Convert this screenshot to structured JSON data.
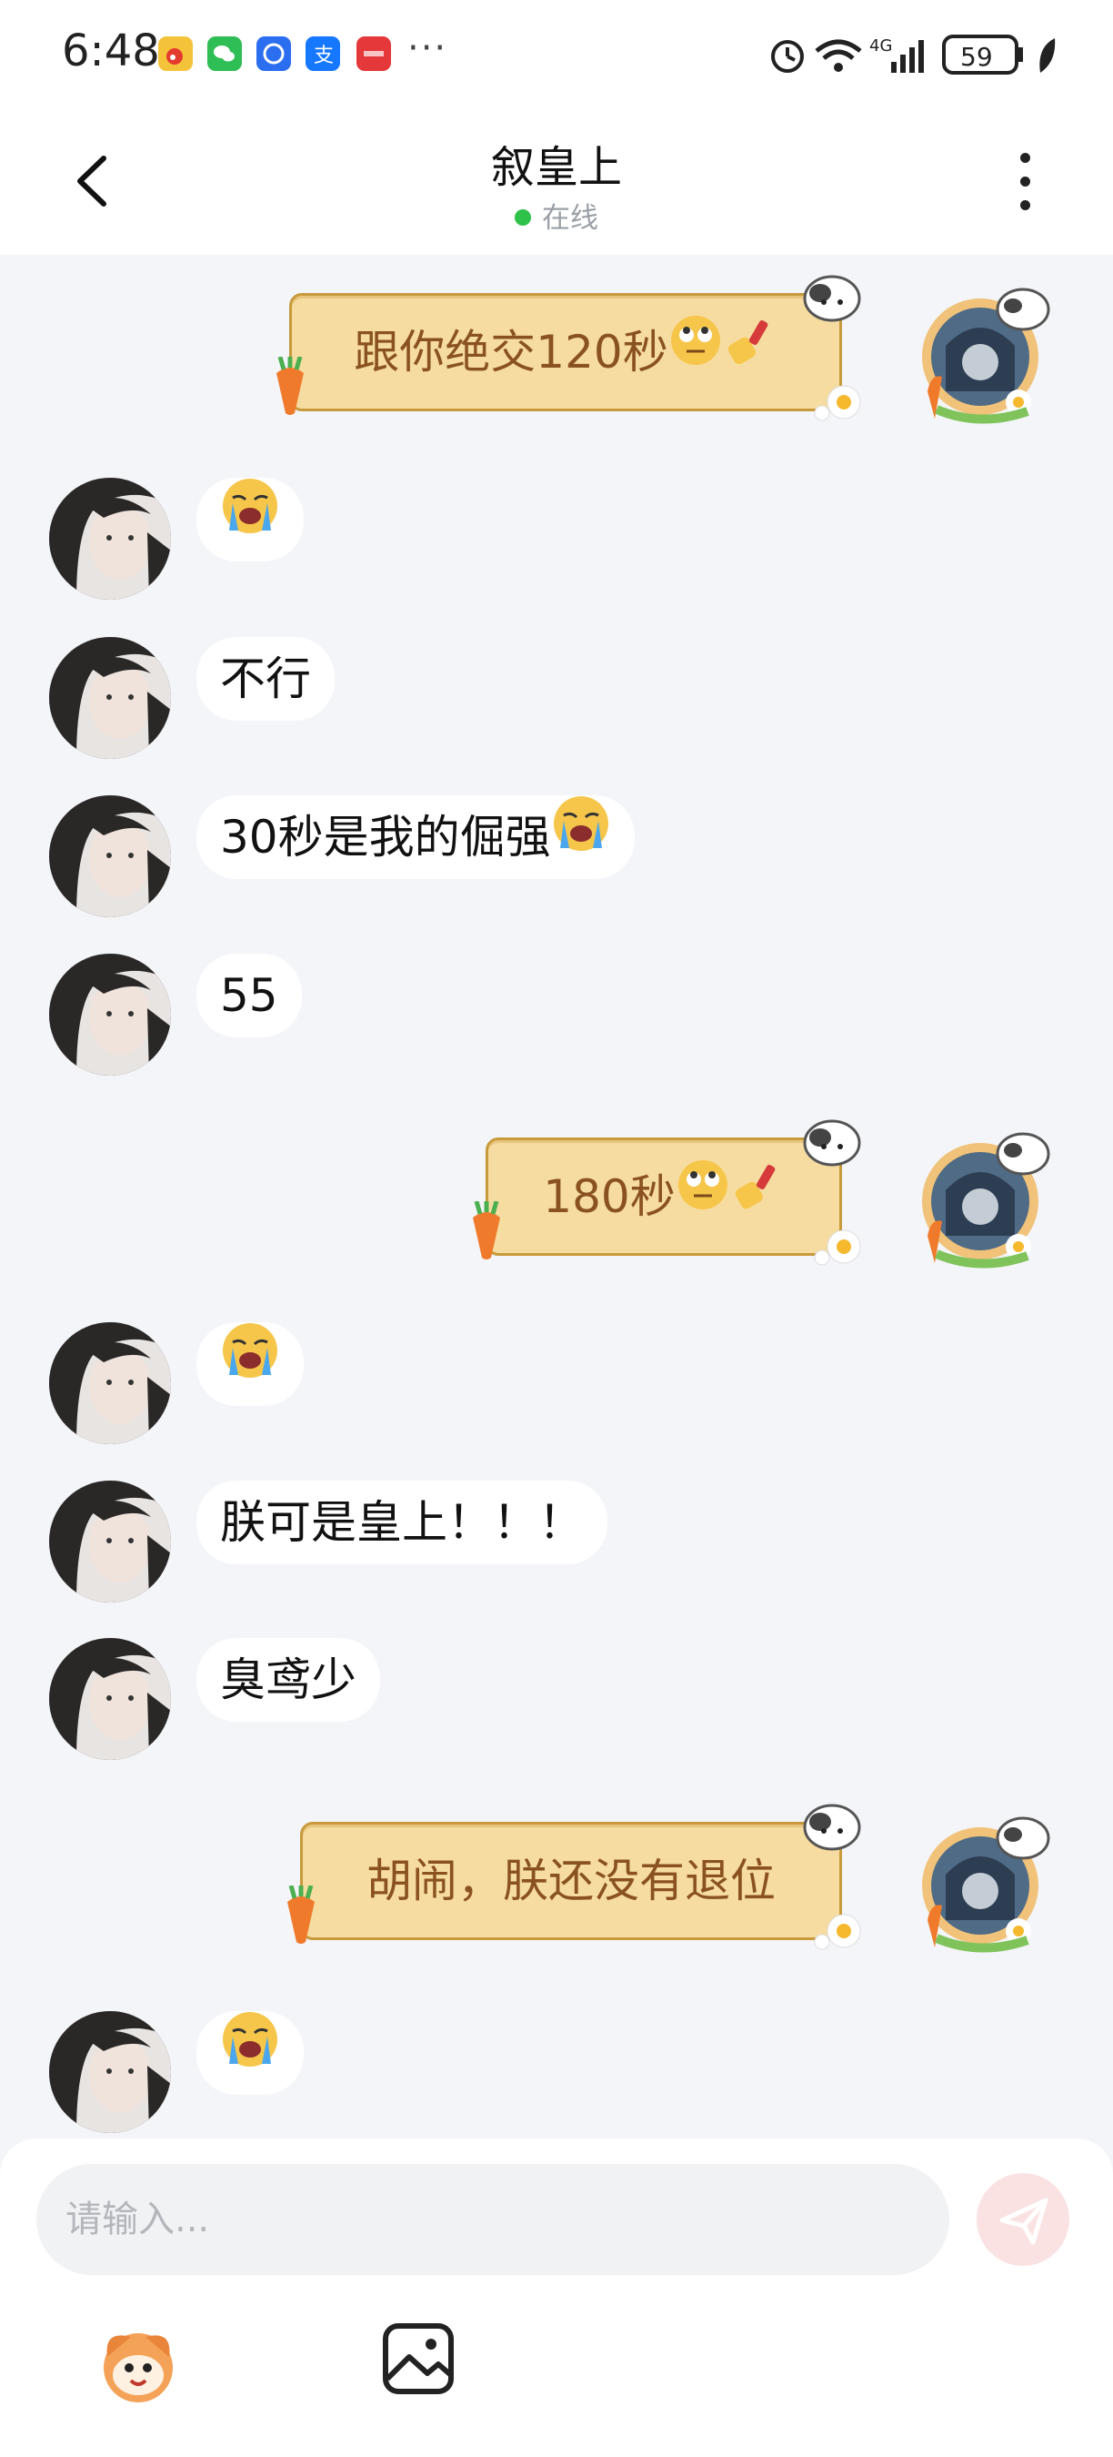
{
  "status_bar": {
    "time": "6:48",
    "more": "···",
    "network": "4G",
    "battery": "59",
    "icons": [
      "weibo-icon",
      "wechat-icon",
      "app-icon",
      "alipay-icon",
      "huawei-icon",
      "alarm-icon",
      "wifi-icon",
      "signal-icon",
      "battery-icon",
      "leaf-icon"
    ]
  },
  "header": {
    "title": "叙皇上",
    "status": "在线",
    "status_color": "#2ec24a"
  },
  "messages": [
    {
      "side": "right",
      "text": "跟你绝交120秒",
      "emoji": [
        "eye-roll",
        "nail-polish"
      ]
    },
    {
      "side": "left",
      "text": "",
      "emoji": [
        "crying"
      ]
    },
    {
      "side": "left",
      "text": "不行",
      "emoji": []
    },
    {
      "side": "left",
      "text": "30秒是我的倔强",
      "emoji": [
        "crying"
      ]
    },
    {
      "side": "left",
      "text": "55",
      "emoji": []
    },
    {
      "side": "right",
      "text": "180秒",
      "emoji": [
        "eye-roll",
        "nail-polish"
      ]
    },
    {
      "side": "left",
      "text": "",
      "emoji": [
        "crying"
      ]
    },
    {
      "side": "left",
      "text": "朕可是皇上！！！",
      "emoji": []
    },
    {
      "side": "left",
      "text": "臭鸢少",
      "emoji": []
    },
    {
      "side": "right",
      "text": "胡闹，朕还没有退位",
      "emoji": []
    },
    {
      "side": "left",
      "text": "",
      "emoji": [
        "crying"
      ]
    }
  ],
  "composer": {
    "placeholder": "请输入...",
    "send_color": "#fbe2e2",
    "tools": [
      "emoji-mascot-icon",
      "image-icon"
    ]
  },
  "colors": {
    "background": "#f3f5f8",
    "right_bubble": "#f6dca0",
    "right_text": "#8a5220",
    "left_bubble": "#ffffff"
  }
}
